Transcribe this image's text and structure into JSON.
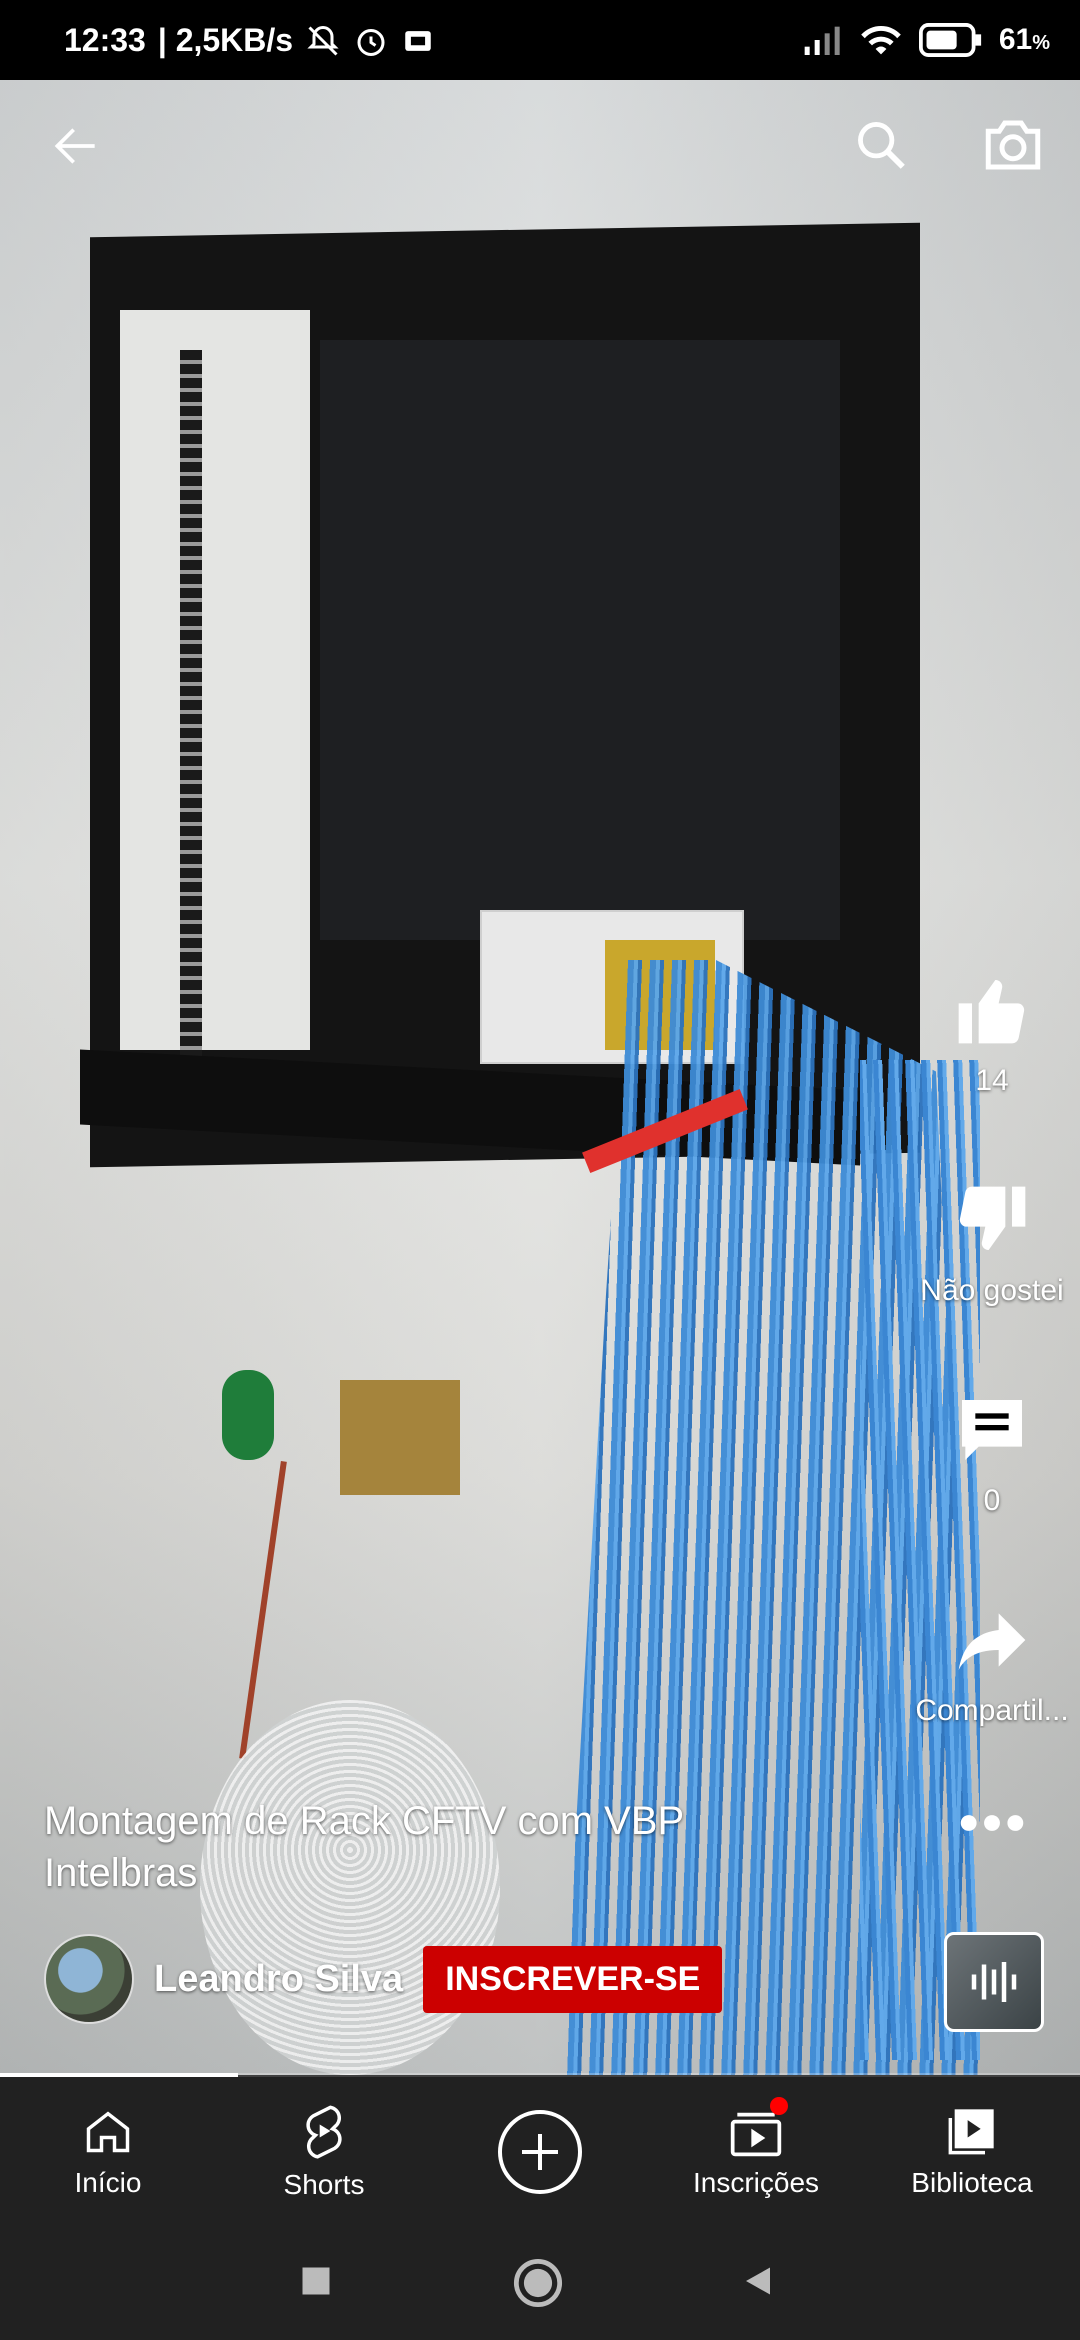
{
  "status_bar": {
    "time": "12:33",
    "speed": "| 2,5KB/s",
    "battery": "61",
    "battery_unit": "%",
    "icons": [
      "bell-off-icon",
      "alarm-icon",
      "sim-icon",
      "signal-icon",
      "wifi-icon",
      "battery-icon"
    ]
  },
  "video": {
    "title": "Montagem de Rack CFTV com  VBP Intelbras",
    "channel": "Leandro Silva",
    "subscribe_label": "INSCREVER-SE",
    "progress": 0.22
  },
  "actions": {
    "like_count": "14",
    "dislike_label": "Não gostei",
    "comment_count": "0",
    "share_label": "Compartil..."
  },
  "nav": {
    "home": "Início",
    "shorts": "Shorts",
    "subscriptions": "Inscrições",
    "library": "Biblioteca"
  },
  "colors": {
    "subscribe": "#cc0000",
    "nav_bg": "#212121",
    "notification_dot": "#ff0000"
  }
}
